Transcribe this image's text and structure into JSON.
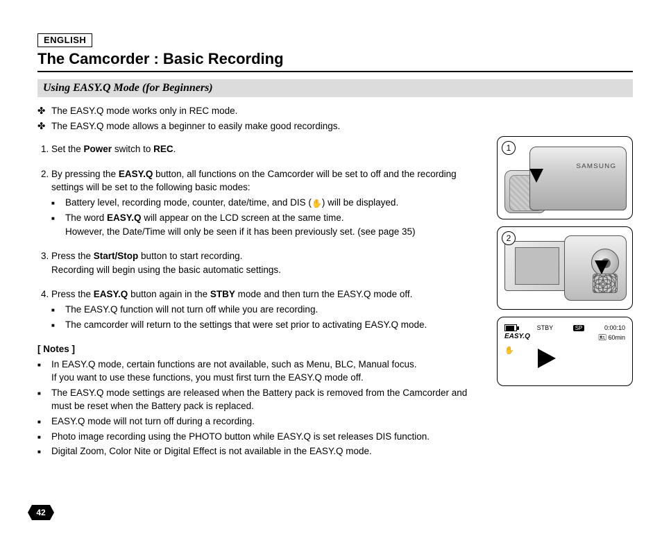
{
  "language_label": "ENGLISH",
  "title": "The Camcorder : Basic Recording",
  "subheading": "Using EASY.Q Mode (for Beginners)",
  "intro_bullets": [
    "The EASY.Q mode works only in REC mode.",
    "The EASY.Q mode allows a beginner to easily make good recordings."
  ],
  "steps": {
    "s1_pre": "Set the ",
    "s1_b1": "Power",
    "s1_mid": " switch to ",
    "s1_b2": "REC",
    "s1_post": ".",
    "s2_pre": "By pressing the ",
    "s2_b1": "EASY.Q",
    "s2_post": " button, all functions on the Camcorder will be set to off and the recording settings will be set to the following basic modes:",
    "s2_sub1": "Battery level, recording mode, counter, date/time, and DIS (",
    "s2_sub1_icon": "✋",
    "s2_sub1_end": ") will be displayed.",
    "s2_sub2_pre": "The word ",
    "s2_sub2_b": "EASY.Q",
    "s2_sub2_mid": " will appear on the LCD screen at the same time.",
    "s2_sub2_line2": "However, the Date/Time will only be seen if it has been previously set. (see page 35)",
    "s3_pre": "Press the ",
    "s3_b1": "Start/Stop",
    "s3_post": " button to start recording.",
    "s3_line2": "Recording will begin using the basic automatic settings.",
    "s4_pre": "Press the ",
    "s4_b1": "EASY.Q",
    "s4_mid": " button again in the ",
    "s4_b2": "STBY",
    "s4_post": " mode and then turn the EASY.Q mode off.",
    "s4_sub1": "The EASY.Q function will not turn off while you are recording.",
    "s4_sub2": "The camcorder will return to the settings that were set prior to activating EASY.Q mode."
  },
  "notes_heading": "[ Notes ]",
  "notes": [
    "In EASY.Q mode, certain functions are not available, such as Menu, BLC, Manual focus.\nIf you want to use these functions, you must first turn the EASY.Q mode off.",
    "The EASY.Q mode settings are released when the Battery pack is removed from the Camcorder and must be reset when the Battery pack is replaced.",
    "EASY.Q mode will not turn off during a recording.",
    "Photo image recording using the PHOTO button while EASY.Q is set releases DIS function.",
    "Digital Zoom, Color Nite or Digital Effect is not available in the EASY.Q mode."
  ],
  "figures": {
    "num1": "1",
    "num2": "2",
    "brand": "SAMSUNG",
    "osd": {
      "stby": "STBY",
      "sp": "SP",
      "time": "0:00:10",
      "easyq": "EASY.Q",
      "remain": "60min",
      "tape_icon": "🖭",
      "hand_icon": "✋"
    }
  },
  "page_number": "42"
}
